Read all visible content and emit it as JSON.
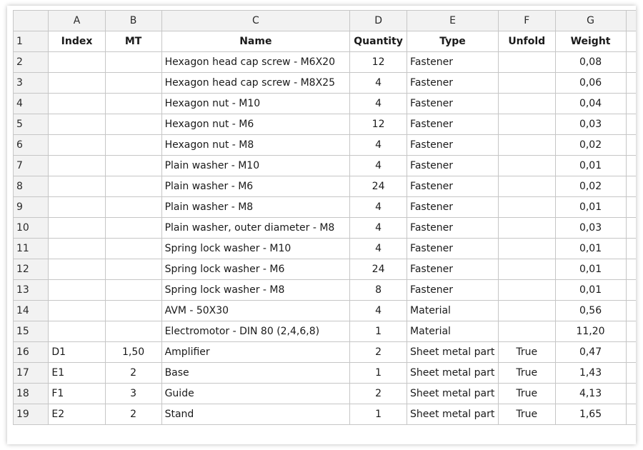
{
  "columns": [
    "A",
    "B",
    "C",
    "D",
    "E",
    "F",
    "G"
  ],
  "header_row": {
    "number": "1",
    "cells": [
      "Index",
      "MT",
      "Name",
      "Quantity",
      "Type",
      "Unfold",
      "Weight"
    ]
  },
  "rows": [
    {
      "number": "2",
      "cells": [
        "",
        "",
        "Hexagon head cap screw - M6X20",
        "12",
        "Fastener",
        "",
        "0,08"
      ]
    },
    {
      "number": "3",
      "cells": [
        "",
        "",
        "Hexagon head cap screw - M8X25",
        "4",
        "Fastener",
        "",
        "0,06"
      ]
    },
    {
      "number": "4",
      "cells": [
        "",
        "",
        "Hexagon nut - M10",
        "4",
        "Fastener",
        "",
        "0,04"
      ]
    },
    {
      "number": "5",
      "cells": [
        "",
        "",
        "Hexagon nut - M6",
        "12",
        "Fastener",
        "",
        "0,03"
      ]
    },
    {
      "number": "6",
      "cells": [
        "",
        "",
        "Hexagon nut - M8",
        "4",
        "Fastener",
        "",
        "0,02"
      ]
    },
    {
      "number": "7",
      "cells": [
        "",
        "",
        "Plain washer - M10",
        "4",
        "Fastener",
        "",
        "0,01"
      ]
    },
    {
      "number": "8",
      "cells": [
        "",
        "",
        "Plain washer - M6",
        "24",
        "Fastener",
        "",
        "0,02"
      ]
    },
    {
      "number": "9",
      "cells": [
        "",
        "",
        "Plain washer - M8",
        "4",
        "Fastener",
        "",
        "0,01"
      ]
    },
    {
      "number": "10",
      "cells": [
        "",
        "",
        "Plain washer, outer diameter - M8",
        "4",
        "Fastener",
        "",
        "0,03"
      ]
    },
    {
      "number": "11",
      "cells": [
        "",
        "",
        "Spring lock washer - M10",
        "4",
        "Fastener",
        "",
        "0,01"
      ]
    },
    {
      "number": "12",
      "cells": [
        "",
        "",
        "Spring lock washer - M6",
        "24",
        "Fastener",
        "",
        "0,01"
      ]
    },
    {
      "number": "13",
      "cells": [
        "",
        "",
        "Spring lock washer - M8",
        "8",
        "Fastener",
        "",
        "0,01"
      ]
    },
    {
      "number": "14",
      "cells": [
        "",
        "",
        "AVM - 50X30",
        "4",
        "Material",
        "",
        "0,56"
      ]
    },
    {
      "number": "15",
      "cells": [
        "",
        "",
        "Electromotor - DIN 80 (2,4,6,8)",
        "1",
        "Material",
        "",
        "11,20"
      ]
    },
    {
      "number": "16",
      "cells": [
        "D1",
        "1,50",
        "Amplifier",
        "2",
        "Sheet metal part",
        "True",
        "0,47"
      ]
    },
    {
      "number": "17",
      "cells": [
        "E1",
        "2",
        "Base",
        "1",
        "Sheet metal part",
        "True",
        "1,43"
      ]
    },
    {
      "number": "18",
      "cells": [
        "F1",
        "3",
        "Guide",
        "2",
        "Sheet metal part",
        "True",
        "4,13"
      ]
    },
    {
      "number": "19",
      "cells": [
        "E2",
        "2",
        "Stand",
        "1",
        "Sheet metal part",
        "True",
        "1,65"
      ]
    }
  ]
}
